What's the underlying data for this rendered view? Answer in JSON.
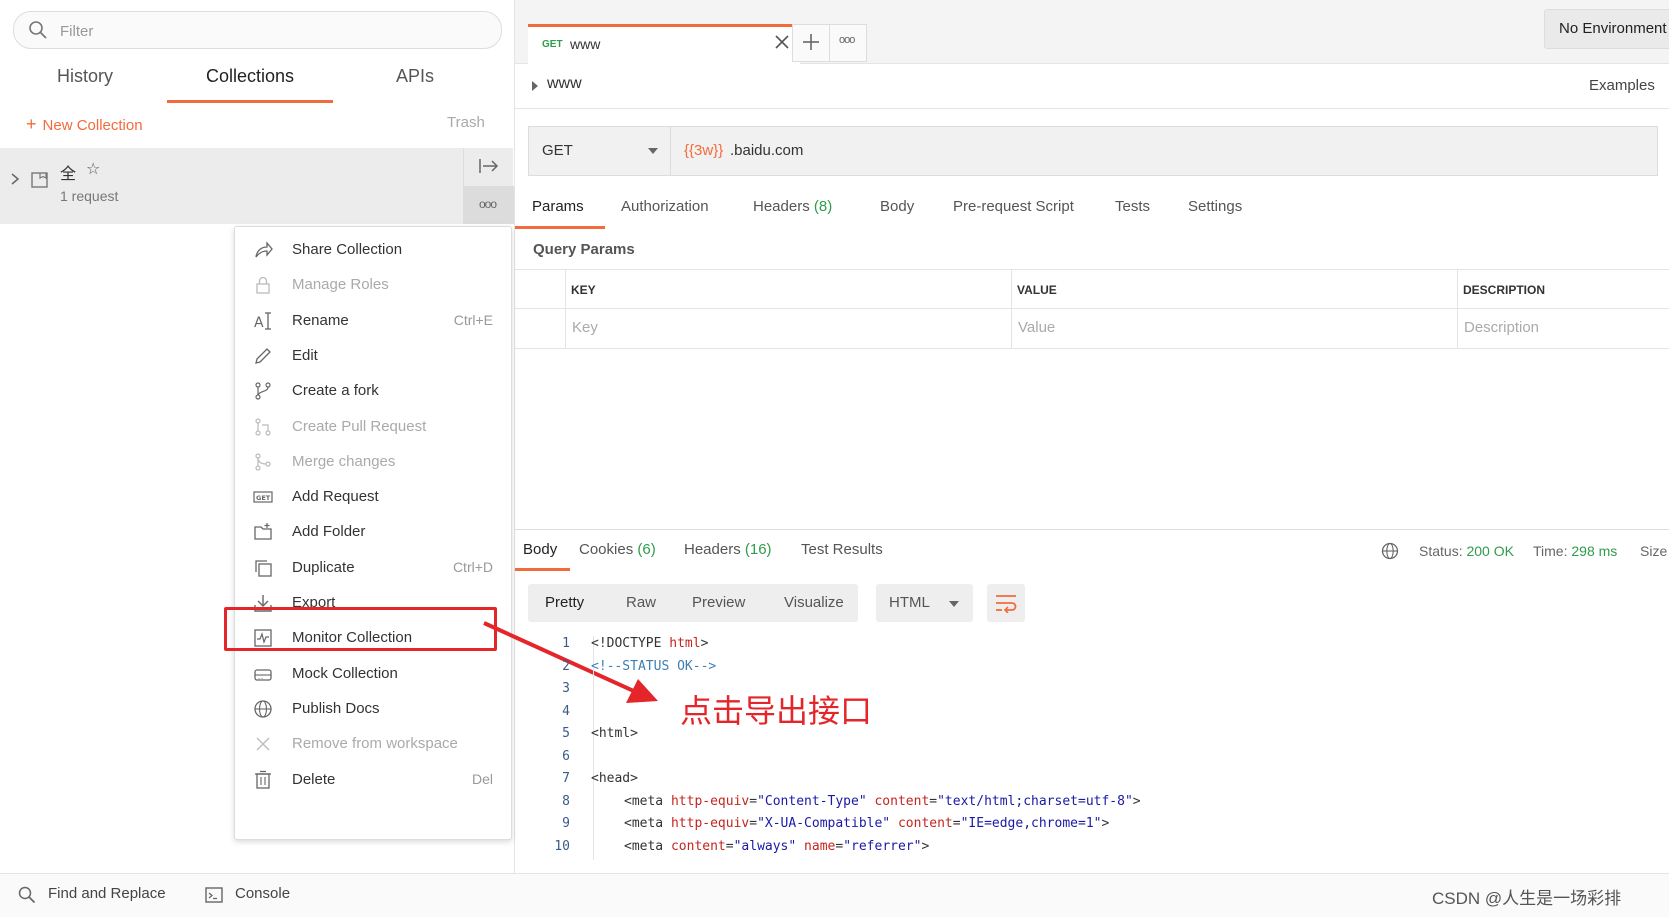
{
  "sidebar": {
    "filter_placeholder": "Filter",
    "tabs": [
      "History",
      "Collections",
      "APIs"
    ],
    "new_collection": "New Collection",
    "trash": "Trash",
    "collection": {
      "name": "全",
      "meta": "1 request"
    }
  },
  "menu": {
    "items": [
      {
        "label": "Share Collection",
        "shortcut": "",
        "icon": "share-icon",
        "disabled": false
      },
      {
        "label": "Manage Roles",
        "shortcut": "",
        "icon": "lock-icon",
        "disabled": true
      },
      {
        "label": "Rename",
        "shortcut": "Ctrl+E",
        "icon": "rename-icon",
        "disabled": false
      },
      {
        "label": "Edit",
        "shortcut": "",
        "icon": "pencil-icon",
        "disabled": false
      },
      {
        "label": "Create a fork",
        "shortcut": "",
        "icon": "fork-icon",
        "disabled": false
      },
      {
        "label": "Create Pull Request",
        "shortcut": "",
        "icon": "pull-request-icon",
        "disabled": true
      },
      {
        "label": "Merge changes",
        "shortcut": "",
        "icon": "merge-icon",
        "disabled": true
      },
      {
        "label": "Add Request",
        "shortcut": "",
        "icon": "get-request-icon",
        "disabled": false
      },
      {
        "label": "Add Folder",
        "shortcut": "",
        "icon": "folder-add-icon",
        "disabled": false
      },
      {
        "label": "Duplicate",
        "shortcut": "Ctrl+D",
        "icon": "duplicate-icon",
        "disabled": false
      },
      {
        "label": "Export",
        "shortcut": "",
        "icon": "export-icon",
        "disabled": false
      },
      {
        "label": "Monitor Collection",
        "shortcut": "",
        "icon": "monitor-icon",
        "disabled": false
      },
      {
        "label": "Mock Collection",
        "shortcut": "",
        "icon": "mock-server-icon",
        "disabled": false
      },
      {
        "label": "Publish Docs",
        "shortcut": "",
        "icon": "globe-icon",
        "disabled": false
      },
      {
        "label": "Remove from workspace",
        "shortcut": "",
        "icon": "close-icon",
        "disabled": true
      },
      {
        "label": "Delete",
        "shortcut": "Del",
        "icon": "trash-icon",
        "disabled": false
      }
    ]
  },
  "annotation": "点击导出接口",
  "request_tab": {
    "method": "GET",
    "name": "www"
  },
  "environment": "No Environment",
  "breadcrumb": "www",
  "examples": "Examples",
  "url": {
    "method": "GET",
    "var": "{{3w}}",
    "rest": ".baidu.com"
  },
  "request_tabs": {
    "params": "Params",
    "authorization": "Authorization",
    "headers": "Headers",
    "headers_count": "(8)",
    "body": "Body",
    "prerequest": "Pre-request Script",
    "tests": "Tests",
    "settings": "Settings"
  },
  "query_params": {
    "title": "Query Params",
    "columns": [
      "KEY",
      "VALUE",
      "DESCRIPTION"
    ],
    "placeholders": [
      "Key",
      "Value",
      "Description"
    ]
  },
  "response": {
    "tabs": {
      "body": "Body",
      "cookies": "Cookies",
      "cookies_count": "(6)",
      "headers": "Headers",
      "headers_count": "(16)",
      "tests": "Test Results"
    },
    "status_label": "Status:",
    "status_value": "200 OK",
    "time_label": "Time:",
    "time_value": "298 ms",
    "size_label": "Size",
    "view_modes": [
      "Pretty",
      "Raw",
      "Preview",
      "Visualize"
    ],
    "format": "HTML"
  },
  "code": {
    "line_numbers": [
      "1",
      "2",
      "3",
      "4",
      "5",
      "6",
      "7",
      "8",
      "9",
      "10"
    ],
    "l1_a": "<!DOCTYPE ",
    "l1_b": "html",
    "l1_c": ">",
    "l2": "<!--STATUS OK-->",
    "l5": "<html>",
    "l7": "<head>",
    "l8_tag": "<meta ",
    "l8_a1": "http-equiv",
    "l8_v1": "\"Content-Type\"",
    "l8_a2": "content",
    "l8_v2": "\"text/html;charset=utf-8\"",
    "l8_end": ">",
    "l9_tag": "<meta ",
    "l9_a1": "http-equiv",
    "l9_v1": "\"X-UA-Compatible\"",
    "l9_a2": "content",
    "l9_v2": "\"IE=edge,chrome=1\"",
    "l9_end": ">",
    "l10_tag": "<meta ",
    "l10_a1": "content",
    "l10_v1": "\"always\"",
    "l10_a2": "name",
    "l10_v2": "\"referrer\"",
    "l10_end": ">"
  },
  "bottom": {
    "find_replace": "Find and Replace",
    "console": "Console",
    "watermark": "CSDN @人生是一场彩排"
  },
  "colors": {
    "accent": "#f26b3a",
    "highlight": "#e4262a",
    "green": "#2e9c4a"
  }
}
